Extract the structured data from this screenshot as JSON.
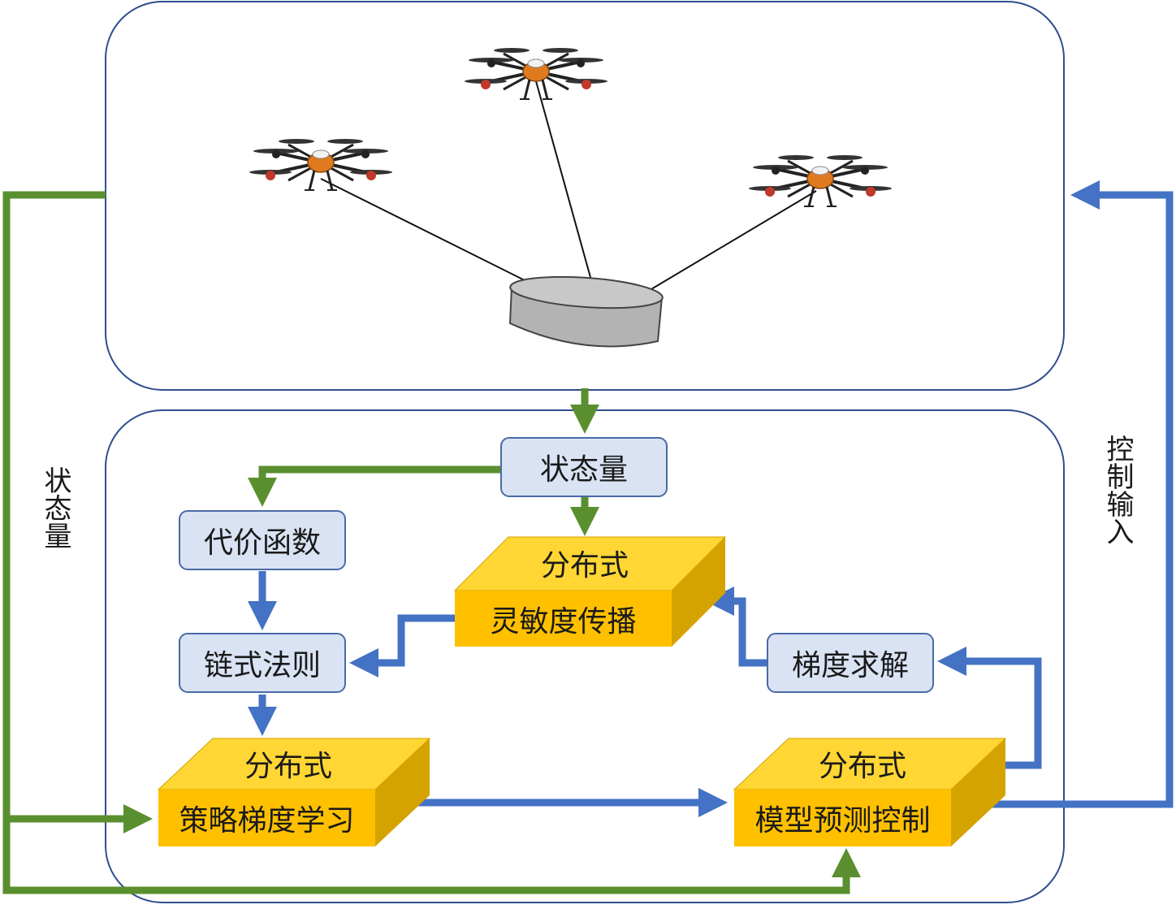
{
  "state_box": "状态量",
  "cost_box": "代价函数",
  "chain_box": "链式法则",
  "gradient_box": "梯度求解",
  "sensitivity_block": {
    "top": "分布式",
    "bottom": "灵敏度传播"
  },
  "policy_block": {
    "top": "分布式",
    "bottom": "策略梯度学习"
  },
  "mpc_block": {
    "top": "分布式",
    "bottom": "模型预测控制"
  },
  "left_side_label": "状态量",
  "right_side_label": "控制输入",
  "colors": {
    "green_arrow": "#5a8f2f",
    "blue_arrow": "#4472c4",
    "panel_border": "#2f4f8f",
    "light_box_fill": "#dae3f3",
    "light_box_border": "#4a6aa8",
    "block_front": "#ffc000",
    "block_top": "#ffd633",
    "block_side": "#d4a300",
    "payload": "#b3b3b3",
    "drone_body": "#e07a1f"
  }
}
